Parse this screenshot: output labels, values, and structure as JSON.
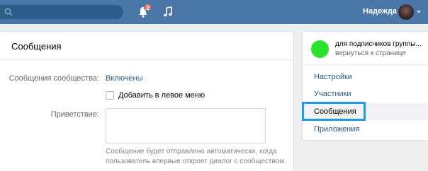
{
  "topbar": {
    "username": "Надежда",
    "notifications_count": "2"
  },
  "main": {
    "title": "Сообщения",
    "community_messages_label": "Сообщения сообщества:",
    "community_messages_value": "Включены",
    "add_to_menu_label": "Добавить в левое меню",
    "greeting_label": "Приветствие:",
    "greeting_value": "",
    "hint_line1": "Сообщение будет отправлено автоматически, когда",
    "hint_line2": "пользователь впервые откроет диалог с сообществом."
  },
  "sidebar": {
    "group_name": "для подписчиков группы...",
    "back_link": "вернуться к странице",
    "items": [
      {
        "label": "Настройки"
      },
      {
        "label": "Участники"
      },
      {
        "label": "Сообщения"
      },
      {
        "label": "Приложения"
      }
    ],
    "active_index": 2
  },
  "colors": {
    "header": "#4a76a8",
    "group_avatar": "#29e42a",
    "highlight": "#1f9ce4",
    "link": "#2a5885"
  }
}
